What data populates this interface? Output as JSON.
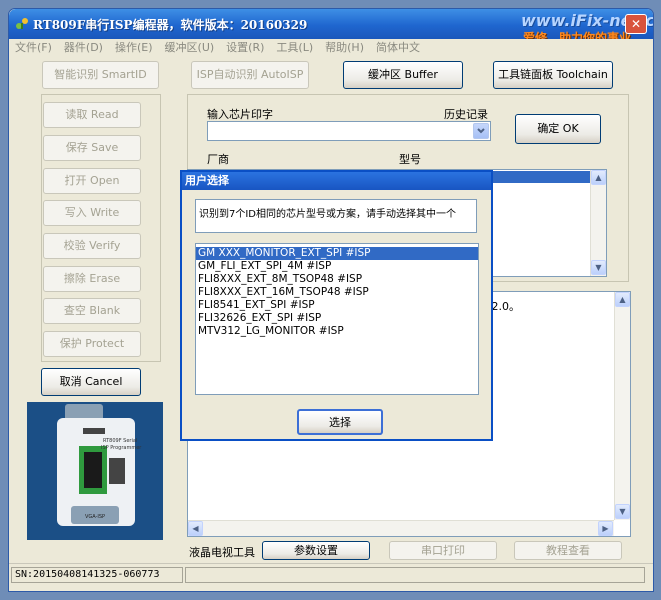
{
  "window": {
    "title": "RT809F串行ISP编程器，软件版本：20160329",
    "watermark_url": "www.iFix-net.cn",
    "watermark_slogan": "爱修，助力你的事业"
  },
  "menu": [
    "文件(F)",
    "器件(D)",
    "操作(E)",
    "缓冲区(U)",
    "设置(R)",
    "工具(L)",
    "帮助(H)",
    "简体中文"
  ],
  "toolbar": {
    "smart_id": "智能识别 SmartID",
    "isp_auto": "ISP自动识别 AutoISP",
    "buffer": "缓冲区 Buffer",
    "toolchain": "工具链面板 Toolchain"
  },
  "actions": {
    "read": "读取 Read",
    "save": "保存 Save",
    "open": "打开 Open",
    "write": "写入 Write",
    "verify": "校验 Verify",
    "erase": "擦除 Erase",
    "blank": "查空 Blank",
    "protect": "保护 Protect",
    "cancel": "取消 Cancel"
  },
  "chip": {
    "input_label": "输入芯片印字",
    "history_label": "历史记录",
    "confirm": "确定 OK",
    "vendor_label": "厂商",
    "model_label": "型号"
  },
  "log_text": "V2.0。",
  "bottom": {
    "lcd_tools": "液晶电视工具",
    "params": "参数设置",
    "serial_print": "串口打印",
    "tutorial": "教程查看"
  },
  "status": {
    "serial": "SN:20150408141325-060773"
  },
  "dialog": {
    "title": "用户选择",
    "message": "识别到7个ID相同的芯片型号或方案，请手动选择其中一个",
    "options": [
      "GM XXX_MONITOR_EXT_SPI #ISP",
      "GM_FLI_EXT_SPI_4M #ISP",
      "FLI8XXX_EXT_8M_TSOP48 #ISP",
      "FLI8XXX_EXT_16M_TSOP48 #ISP",
      "FLI8541_EXT_SPI #ISP",
      "FLI32626_EXT_SPI #ISP",
      "MTV312_LG_MONITOR #ISP"
    ],
    "selected_index": 0,
    "select_button": "选择"
  },
  "colors": {
    "title_bar": "#1f66cf",
    "selection": "#316ac5",
    "window_bg": "#ece9d8"
  }
}
